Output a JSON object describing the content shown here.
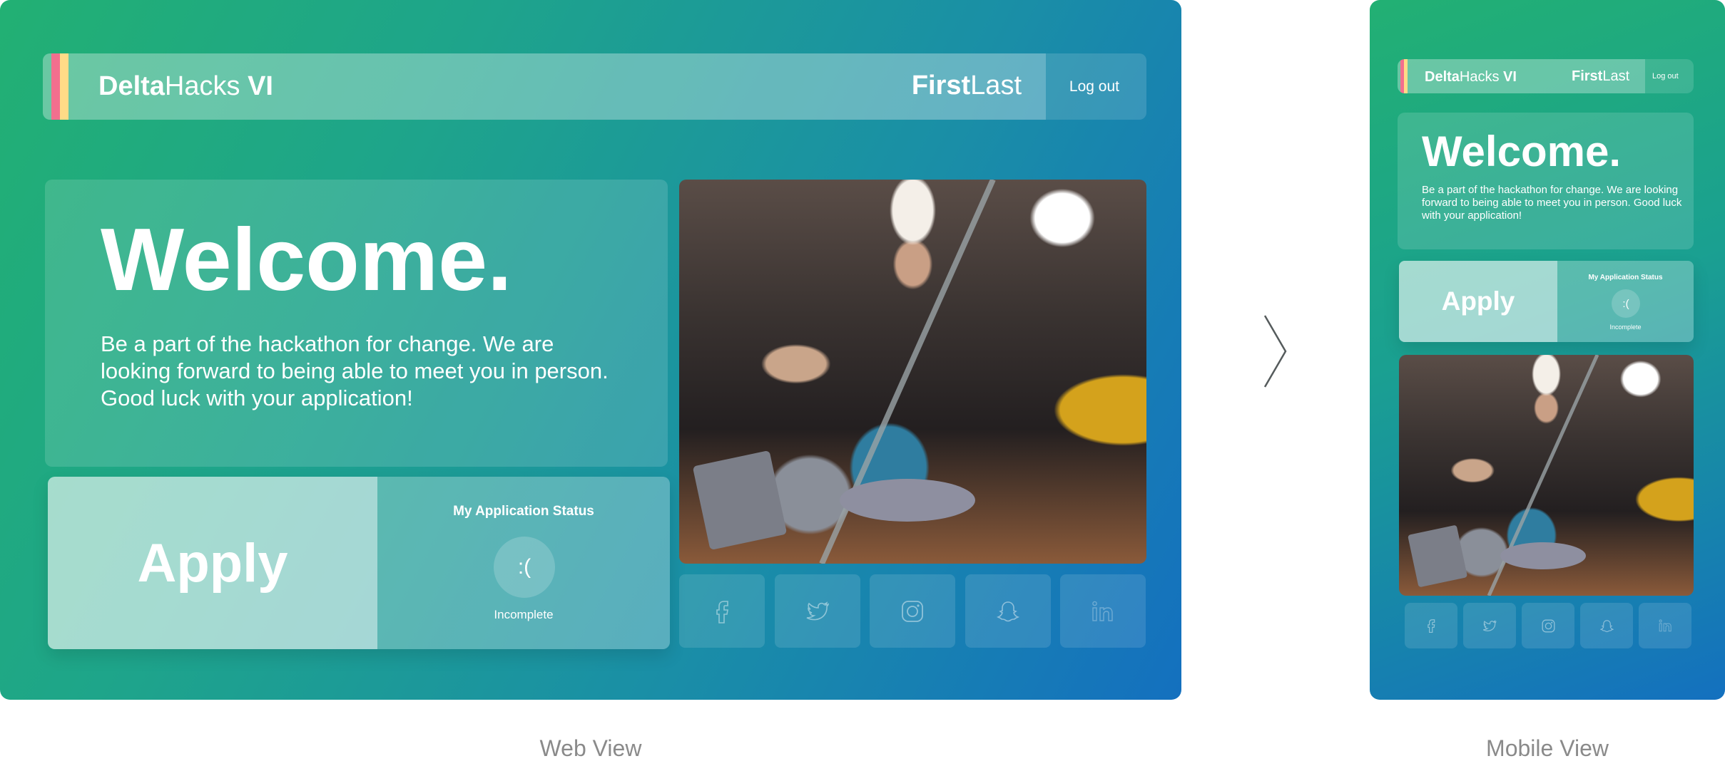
{
  "brand": {
    "name_bold": "Delta",
    "name_regular": "Hacks",
    "suffix": "VI"
  },
  "user": {
    "first": "First",
    "last": "Last"
  },
  "logout_label": "Log out",
  "welcome": {
    "title": "Welcome.",
    "body": "Be a part of the hackathon for change. We are looking forward to being able to meet you in person. Good luck with your application!"
  },
  "apply_label": "Apply",
  "status": {
    "heading": "My Application Status",
    "face": ":(",
    "value": "Incomplete"
  },
  "social": [
    "facebook-icon",
    "twitter-icon",
    "instagram-icon",
    "snapchat-icon",
    "linkedin-icon"
  ],
  "captions": {
    "web": "Web View",
    "mobile": "Mobile View"
  },
  "colors": {
    "stripe_red": "#ef476f",
    "stripe_yellow": "#ffd166",
    "gradient_start": "#22b073",
    "gradient_end": "#1470bf"
  }
}
